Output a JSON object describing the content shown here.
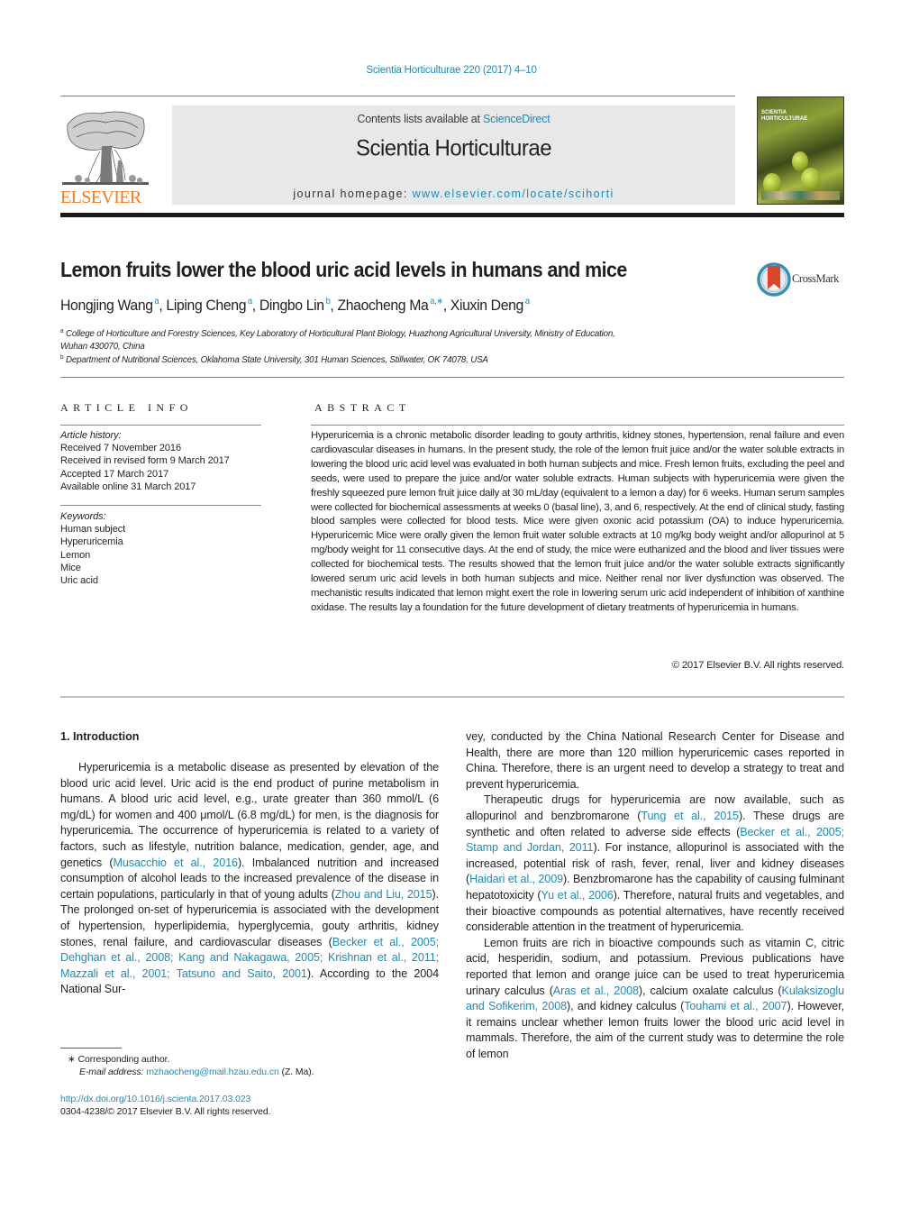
{
  "header": {
    "journal_ref": "Scientia Horticulturae 220 (2017) 4–10",
    "contents_prefix": "Contents lists available at ",
    "contents_link": "ScienceDirect",
    "journal_name": "Scientia Horticulturae",
    "homepage_prefix": "journal homepage: ",
    "homepage_link": "www.elsevier.com/locate/scihorti",
    "publisher_logo": "ELSEVIER",
    "cover_title_1": "SCIENTIA",
    "cover_title_2": "HORTICULTURAE",
    "crossmark_label": "CrossMark"
  },
  "article": {
    "title": "Lemon fruits lower the blood uric acid levels in humans and mice",
    "authors": [
      {
        "name": "Hongjing Wang",
        "sup": "a"
      },
      {
        "name": "Liping Cheng",
        "sup": "a"
      },
      {
        "name": "Dingbo Lin",
        "sup": "b"
      },
      {
        "name": "Zhaocheng Ma",
        "sup": "a,∗"
      },
      {
        "name": "Xiuxin Deng",
        "sup": "a"
      }
    ],
    "affiliations": [
      {
        "mark": "a",
        "line1": "College of Horticulture and Forestry Sciences, Key Laboratory of Horticultural Plant Biology, Huazhong Agricultural University, Ministry of Education,",
        "line2": "Wuhan 430070, China"
      },
      {
        "mark": "b",
        "line1": "Department of Nutritional Sciences, Oklahoma State University, 301 Human Sciences, Stillwater, OK 74078, USA"
      }
    ]
  },
  "article_info": {
    "heading": "ARTICLE INFO",
    "history_label": "Article history:",
    "history": [
      "Received 7 November 2016",
      "Received in revised form 9 March 2017",
      "Accepted 17 March 2017",
      "Available online 31 March 2017"
    ],
    "keywords_label": "Keywords:",
    "keywords": [
      "Human subject",
      "Hyperuricemia",
      "Lemon",
      "Mice",
      "Uric acid"
    ]
  },
  "abstract": {
    "heading": "ABSTRACT",
    "text": "Hyperuricemia is a chronic metabolic disorder leading to gouty arthritis, kidney stones, hypertension, renal failure and even cardiovascular diseases in humans. In the present study, the role of the lemon fruit juice and/or the water soluble extracts in lowering the blood uric acid level was evaluated in both human subjects and mice. Fresh lemon fruits, excluding the peel and seeds, were used to prepare the juice and/or water soluble extracts. Human subjects with hyperuricemia were given the freshly squeezed pure lemon fruit juice daily at 30 mL/day (equivalent to a lemon a day) for 6 weeks. Human serum samples were collected for biochemical assessments at weeks 0 (basal line), 3, and 6, respectively. At the end of clinical study, fasting blood samples were collected for blood tests. Mice were given oxonic acid potassium (OA) to induce hyperuricemia. Hyperuricemic Mice were orally given the lemon fruit water soluble extracts at 10 mg/kg body weight and/or allopurinol at 5 mg/body weight for 11 consecutive days. At the end of study, the mice were euthanized and the blood and liver tissues were collected for biochemical tests. The results showed that the lemon fruit juice and/or the water soluble extracts significantly lowered serum uric acid levels in both human subjects and mice. Neither renal nor liver dysfunction was observed. The mechanistic results indicated that lemon might exert the role in lowering serum uric acid independent of inhibition of xanthine oxidase. The results lay a foundation for the future development of dietary treatments of hyperuricemia in humans.",
    "copyright": "© 2017 Elsevier B.V. All rights reserved."
  },
  "body": {
    "intro_heading": "1.  Introduction",
    "left_p1": [
      {
        "t": "Hyperuricemia is a metabolic disease as presented by elevation of the blood uric acid level. Uric acid is the end product of purine metabolism in humans. A blood uric acid level, e.g., urate greater than 360 mmol/L (6 mg/dL) for women and 400 μmol/L (6.8 mg/dL) for men, is the diagnosis for hyperuricemia. The occurrence of hyperuricemia is related to a variety of factors, such as lifestyle, nutrition balance, medication, gender, age, and genetics ("
      },
      {
        "t": "Musacchio et al., 2016",
        "link": true
      },
      {
        "t": "). Imbalanced nutrition and increased consumption of alcohol leads to the increased prevalence of the disease in certain populations, particularly in that of young adults ("
      },
      {
        "t": "Zhou and Liu, 2015",
        "link": true
      },
      {
        "t": "). The prolonged on-set of hyperuricemia is associated with the development of hypertension, hyperlipidemia, hyperglycemia, gouty arthritis, kidney stones, renal failure, and cardiovascular diseases ("
      },
      {
        "t": "Becker et al., 2005; Dehghan et al., 2008; Kang and Nakagawa, 2005; Krishnan et al., 2011; Mazzali et al., 2001; Tatsuno and Saito, 2001",
        "link": true
      },
      {
        "t": "). According to the 2004 National Sur-"
      }
    ],
    "right_p1": "vey, conducted by the China National Research Center for Disease and Health, there are more than 120 million hyperuricemic cases reported in China. Therefore, there is an urgent need to develop a strategy to treat and prevent hyperuricemia.",
    "right_p2": [
      {
        "t": "Therapeutic drugs for hyperuricemia are now available, such as allopurinol and benzbromarone ("
      },
      {
        "t": "Tung et al., 2015",
        "link": true
      },
      {
        "t": "). These drugs are synthetic and often related to adverse side effects ("
      },
      {
        "t": "Becker et al., 2005; Stamp and Jordan, 2011",
        "link": true
      },
      {
        "t": "). For instance, allopurinol is associated with the increased, potential risk of rash, fever, renal, liver and kidney diseases ("
      },
      {
        "t": "Haidari et al., 2009",
        "link": true
      },
      {
        "t": "). Benzbromarone has the capability of causing fulminant hepatotoxicity ("
      },
      {
        "t": "Yu et al., 2006",
        "link": true
      },
      {
        "t": "). Therefore, natural fruits and vegetables, and their bioactive compounds as potential alternatives, have recently received considerable attention in the treatment of hyperuricemia."
      }
    ],
    "right_p3": [
      {
        "t": "Lemon fruits are rich in bioactive compounds such as vitamin C, citric acid, hesperidin, sodium, and potassium. Previous publications have reported that lemon and orange juice can be used to treat hyperuricemia urinary calculus ("
      },
      {
        "t": "Aras et al., 2008",
        "link": true
      },
      {
        "t": "), calcium oxalate calculus ("
      },
      {
        "t": "Kulaksizoglu and Sofikerim, 2008",
        "link": true
      },
      {
        "t": "), and kidney calculus ("
      },
      {
        "t": "Touhami et al., 2007",
        "link": true
      },
      {
        "t": "). However, it remains unclear whether lemon fruits lower the blood uric acid level in mammals. Therefore, the aim of the current study was to determine the role of lemon"
      }
    ]
  },
  "footnotes": {
    "corresponding": "∗  Corresponding author.",
    "email_label": "E-mail address: ",
    "email": "mzhaocheng@mail.hzau.edu.cn",
    "email_suffix": " (Z. Ma).",
    "doi": "http://dx.doi.org/10.1016/j.scienta.2017.03.023",
    "issn_copyright": "0304-4238/© 2017 Elsevier B.V. All rights reserved."
  },
  "colors": {
    "link": "#1f8ab5",
    "elsevier_orange": "#f47b20",
    "banner_bg": "#e7e8e9",
    "text": "#231f20"
  }
}
